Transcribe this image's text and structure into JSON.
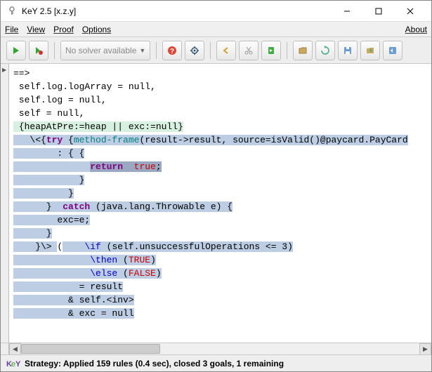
{
  "window": {
    "title": "KeY 2.5 [x.z.y]"
  },
  "menu": {
    "file": "File",
    "view": "View",
    "proof": "Proof",
    "options": "Options",
    "about": "About"
  },
  "toolbar": {
    "solver_text": "No solver available"
  },
  "code": {
    "l1": "==>",
    "l2": " self.log.logArray = null,",
    "l3": " self.log = null,",
    "l4": " self = null,",
    "l5_a": " {heapAtPre:=heap || exc:=null}",
    "l6_a": "   \\<{",
    "l6_b": "try",
    "l6_c": " {",
    "l6_d": "method-frame",
    "l6_e": "(result->result, source=isValid()@paycard.PayCard",
    "l7": "        : { {",
    "l8_a": "              ",
    "l8_b": "return",
    "l8_c": "  ",
    "l8_d": "true",
    "l8_e": ";",
    "l9": "            }",
    "l10": "          }",
    "l11_a": "      }  ",
    "l11_b": "catch",
    "l11_c": " (java.lang.Throwable e) {",
    "l12": "        exc=e;",
    "l13": "      }",
    "l14_a": "    }\\> ",
    "l14_b": "(",
    "l14_c": "    ",
    "l14_d": "\\if",
    "l14_e": " (self.unsuccessfulOperations <= 3)",
    "l15_a": "              ",
    "l15_b": "\\then",
    "l15_c": " (",
    "l15_d": "TRUE",
    "l15_e": ")",
    "l16_a": "              ",
    "l16_b": "\\else",
    "l16_c": " (",
    "l16_d": "FALSE",
    "l16_e": ")",
    "l17": "            = result",
    "l18": "          & self.<inv>",
    "l19": "          & exc = null"
  },
  "status": {
    "text": "Strategy: Applied 159 rules (0.4 sec),  closed 3 goals, 1 remaining"
  }
}
